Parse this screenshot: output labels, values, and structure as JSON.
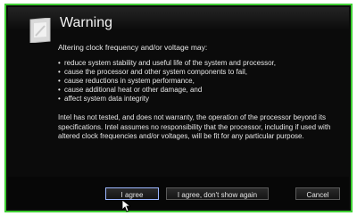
{
  "dialog": {
    "title": "Warning",
    "intro": "Altering clock frequency and/or voltage may:",
    "bullets": [
      "reduce system stability and useful life of the system and processor,",
      "cause the processor and other system components to fail,",
      "cause reductions in system performance,",
      "cause additional heat or other damage, and",
      "affect system data integrity"
    ],
    "disclaimer": "Intel has not tested, and does not warranty, the operation of the processor beyond its specifications. Intel assumes no responsibility that the processor, including if used with altered clock frequencies and/or voltages, will be fit for any particular purpose."
  },
  "buttons": {
    "agree": "I agree",
    "agree_no_show": "I agree, don't show again",
    "cancel": "Cancel"
  },
  "icons": {
    "warning": "warning-icon",
    "cursor": "mouse-cursor-icon"
  },
  "colors": {
    "dialog_bg": "#0b0b0b",
    "border": "#3fcf34",
    "text": "#e6e6e6"
  }
}
